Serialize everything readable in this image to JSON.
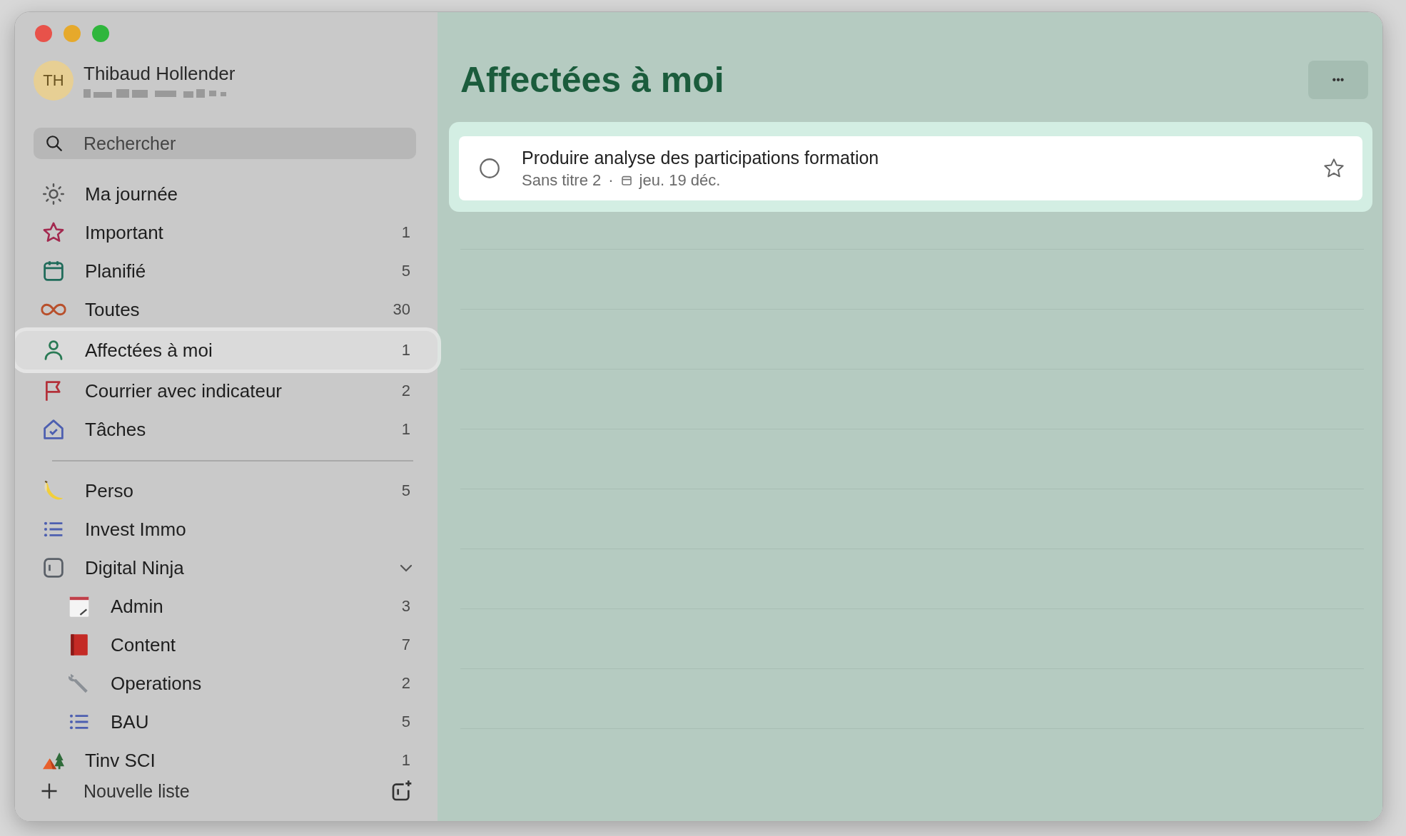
{
  "user": {
    "initials": "TH",
    "name": "Thibaud Hollender"
  },
  "search": {
    "placeholder": "Rechercher"
  },
  "smart_lists": [
    {
      "label": "Ma journée",
      "selected": false
    },
    {
      "label": "Important",
      "count": "1",
      "selected": false
    },
    {
      "label": "Planifié",
      "count": "5",
      "selected": false
    },
    {
      "label": "Toutes",
      "count": "30",
      "selected": false
    },
    {
      "label": "Affectées à moi",
      "count": "1",
      "selected": true
    },
    {
      "label": "Courrier avec indicateur",
      "count": "2",
      "selected": false
    },
    {
      "label": "Tâches",
      "count": "1",
      "selected": false
    }
  ],
  "lists": [
    {
      "label": "Perso",
      "count": "5",
      "selected": false
    },
    {
      "label": "Invest Immo",
      "selected": false
    },
    {
      "label": "Digital Ninja",
      "kind": "group",
      "expanded": true,
      "selected": false,
      "children": [
        {
          "label": "Admin",
          "count": "3",
          "selected": false
        },
        {
          "label": "Content",
          "count": "7",
          "selected": false
        },
        {
          "label": "Operations",
          "count": "2",
          "selected": false
        },
        {
          "label": "BAU",
          "count": "5",
          "selected": false
        }
      ]
    },
    {
      "label": "Tinv SCI",
      "count": "1",
      "selected": false
    }
  ],
  "new_list": {
    "label": "Nouvelle liste"
  },
  "main": {
    "title": "Affectées à moi",
    "more": "•••",
    "tasks": [
      {
        "title": "Produire analyse des participations formation",
        "list": "Sans titre 2",
        "separator": "·",
        "due": "jeu. 19 déc.",
        "completed": false,
        "important": false,
        "selected": true
      }
    ]
  }
}
